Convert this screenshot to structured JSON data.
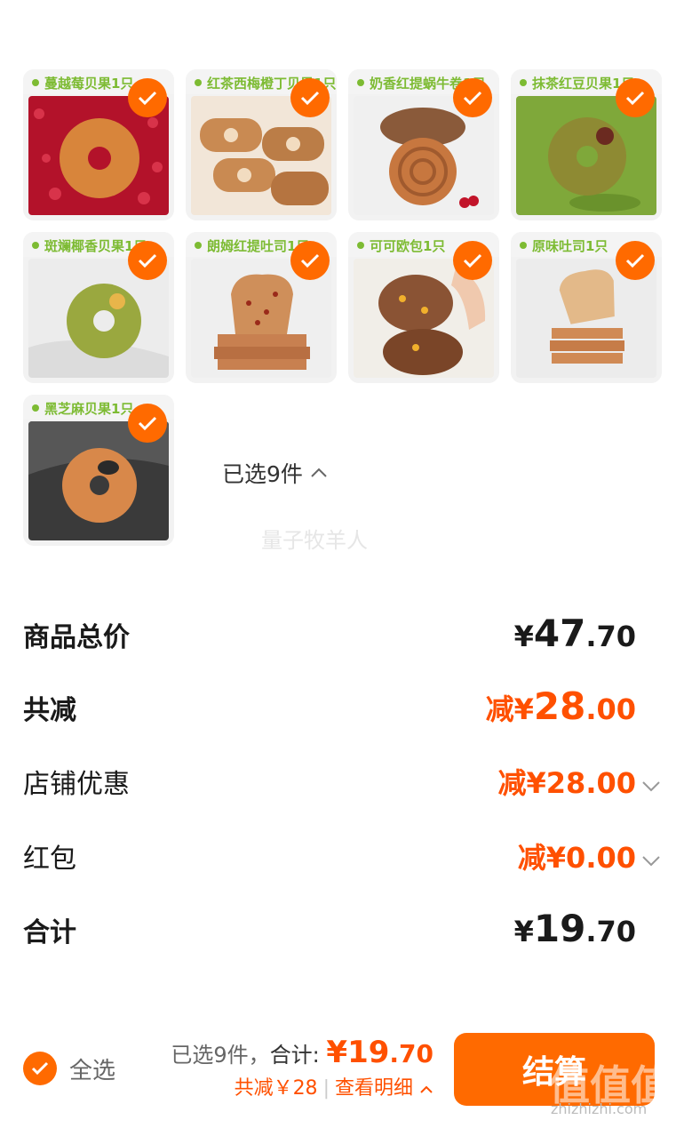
{
  "products": [
    {
      "name": "蔓越莓贝果1只",
      "image": "cranberry-bagel"
    },
    {
      "name": "红茶西梅橙丁贝果1只",
      "image": "black-tea-prune-bagel"
    },
    {
      "name": "奶香红提蜗牛卷1只",
      "image": "raisin-snail-roll"
    },
    {
      "name": "抹茶红豆贝果1只",
      "image": "matcha-red-bean-bagel"
    },
    {
      "name": "斑斓椰香贝果1只",
      "image": "pandan-coconut-bagel"
    },
    {
      "name": "朗姆红提吐司1只",
      "image": "rum-raisin-toast"
    },
    {
      "name": "可可欧包1只",
      "image": "cocoa-bread"
    },
    {
      "name": "原味吐司1只",
      "image": "plain-toast"
    },
    {
      "name": "黑芝麻贝果1只",
      "image": "black-sesame-bagel"
    }
  ],
  "selection": {
    "label": "已选9件",
    "icon": "chevron-up-icon"
  },
  "watermark": "量子牧羊人",
  "breakdown": {
    "total": {
      "label": "商品总价",
      "currency": "¥",
      "int": "47",
      "dec": ".70"
    },
    "discount": {
      "label": "共减",
      "prefix": "减¥",
      "int": "28",
      "dec": ".00"
    },
    "shop": {
      "label": "店铺优惠",
      "prefix": "减¥",
      "int": "28",
      "dec": ".00"
    },
    "redpacket": {
      "label": "红包",
      "prefix": "减¥",
      "int": "0",
      "dec": ".00"
    },
    "sum": {
      "label": "合计",
      "currency": "¥",
      "int": "19",
      "dec": ".70"
    }
  },
  "bottom": {
    "select_all": "全选",
    "count": "已选9件，",
    "sum_label": "合计: ",
    "sum_int": "¥19",
    "sum_dec": ".70",
    "discount": "共减￥28",
    "details": "查看明细",
    "checkout": "结算"
  },
  "site": {
    "mark": "值值值",
    "url": "zhizhizhi.com"
  },
  "colors": {
    "accent": "#ff6a00",
    "discount": "#ff5000",
    "tag_green": "#7dbb33"
  }
}
